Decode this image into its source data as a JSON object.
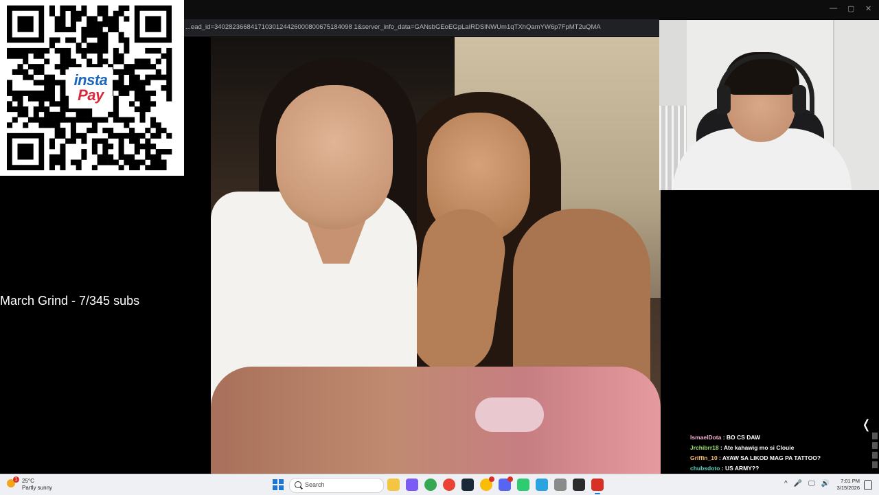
{
  "browser": {
    "url": "...ead_id=34028236684171030124426000800675184098 1&server_info_data=GANsbGEoEGpLaIRDSlNWUm1qTXhQamYW6p7FpMT2uQMA",
    "window_controls": [
      "—",
      "▢",
      "✕"
    ]
  },
  "qr": {
    "logo_line1": "insta",
    "logo_line2": "Pay"
  },
  "overlay": {
    "goal_text": "March Grind - 7/345 subs"
  },
  "chat": {
    "messages": [
      {
        "user": "IsmaelDota",
        "text": " : BO CS DAW",
        "color": "#f4b4d2"
      },
      {
        "user": "Jrchibrr18",
        "text": " : Ate kahawig mo si Clouie",
        "color": "#9ee36b"
      },
      {
        "user": "Griffin_10",
        "text": " : AYAW SA LIKOD MAG PA TATTOO?",
        "color": "#f6c06b"
      },
      {
        "user": "chubsdoto",
        "text": " : US ARMY??",
        "color": "#5fd3c0"
      }
    ],
    "collapse_glyph": "❬"
  },
  "taskbar": {
    "weather": {
      "temp": "25°C",
      "condition": "Partly sunny",
      "badge": "1"
    },
    "search_label": "Search",
    "apps": [
      {
        "name": "file-explorer",
        "color": "#f4c542"
      },
      {
        "name": "copilot",
        "color": "#7a5cf5"
      },
      {
        "name": "chrome-1",
        "color": "#34a853"
      },
      {
        "name": "chrome-2",
        "color": "#ea4335"
      },
      {
        "name": "steam",
        "color": "#1b2838"
      },
      {
        "name": "chrome-3",
        "color": "#fbbc05"
      },
      {
        "name": "discord",
        "color": "#5865f2"
      },
      {
        "name": "app-green",
        "color": "#2ecc71"
      },
      {
        "name": "telegram",
        "color": "#2aa3e0"
      },
      {
        "name": "app-doc",
        "color": "#8a8a8a"
      },
      {
        "name": "obs",
        "color": "#2b2b2b"
      },
      {
        "name": "app-red",
        "color": "#d93025"
      }
    ],
    "tray": [
      "^",
      "🎤",
      "🖵",
      "🔊"
    ],
    "time": "7:01 PM",
    "date": "3/15/2026"
  }
}
